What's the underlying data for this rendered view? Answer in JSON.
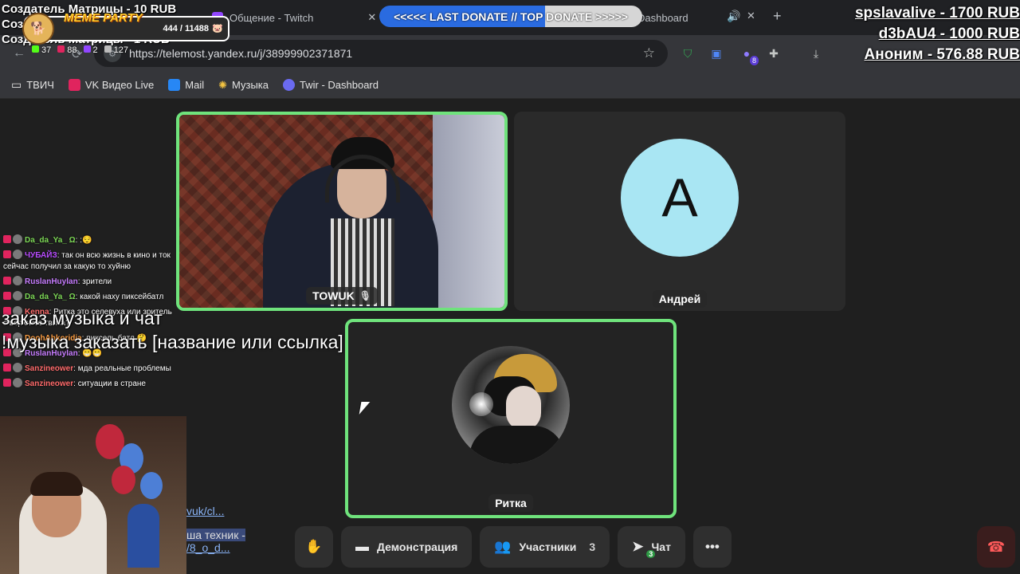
{
  "browser": {
    "tabs": [
      {
        "title": "Общение - Twitch"
      },
      {
        "title": "Dashboard"
      }
    ],
    "url": "https://telemost.yandex.ru/j/38999902371871",
    "bookmarks": [
      {
        "label": "ТВИЧ",
        "icon": "folder-icon"
      },
      {
        "label": "VK Видео Live",
        "icon": "vk-live-icon"
      },
      {
        "label": "Mail",
        "icon": "mail-icon"
      },
      {
        "label": "Музыка",
        "icon": "music-icon"
      },
      {
        "label": "Twir - Dashboard",
        "icon": "twir-icon"
      }
    ],
    "extension_badge": "8"
  },
  "meeting": {
    "participants": [
      {
        "name": "TOWUK",
        "speaking": true
      },
      {
        "name": "Андрей",
        "initial": "А",
        "avatar_color": "#a9e6f3",
        "speaking": false
      },
      {
        "name": "Ритка",
        "speaking": true
      }
    ],
    "controls": {
      "demo_label": "Демонстрация",
      "participants_label": "Участники",
      "participants_count": "3",
      "chat_label": "Чат",
      "chat_badge": "3"
    }
  },
  "overlay": {
    "top_left_lines": [
      "Создатель Матрицы - 10 RUB",
      "Соз",
      "Создатель Матрицы - 1 RUB"
    ],
    "meme_party": {
      "title": "MEME PARTY",
      "progress": "444 / 11488"
    },
    "stats": [
      "37",
      "88",
      "2",
      "127"
    ],
    "donate_banner": "<<<<< LAST DONATE // TOP DONATE >>>>>",
    "top_donors": [
      "spslavalive - 1700 RUB",
      "d3bAU4 - 1000 RUB",
      "Аноним - 576.88 RUB"
    ],
    "chat": [
      {
        "nick": "Da_da_Ya_ Ω",
        "nick_color": "#7ed957",
        "text": ":😌"
      },
      {
        "nick": "ЧУБАЙЗ",
        "nick_color": "#b84cff",
        "text": "так он всю жизнь в кино и ток сейчас получил за какую то хуйню"
      },
      {
        "nick": "RuslanHuylan",
        "nick_color": "#c77dff",
        "text": "зрители"
      },
      {
        "nick": "Da_da_Ya_ Ω",
        "nick_color": "#7ed957",
        "text": "какой наху пиксейбатл"
      },
      {
        "nick": "Kenna",
        "nick_color": "#ff6b6b",
        "text": "Ритка это селевуха или зритель с верхнего твича?"
      },
      {
        "nick": "DoohAhkoridja",
        "nick_color": "#ff9f43",
        "text": "пиксель батл 🤔"
      },
      {
        "nick": "RuslanHuylan",
        "nick_color": "#c77dff",
        "text": "😁😁"
      },
      {
        "nick": "Sanzineower",
        "nick_color": "#ff6b6b",
        "text": "мда реальные проблемы"
      },
      {
        "nick": "Sanzineower",
        "nick_color": "#ff6b6b",
        "text": "ситуации в стране"
      }
    ],
    "order_lines": [
      "заказ музыка и чат",
      "!музыка заказать [название или ссылка]"
    ],
    "snippets": [
      "vuk/cl...",
      "ша техник -",
      "/8_o_d..."
    ]
  }
}
